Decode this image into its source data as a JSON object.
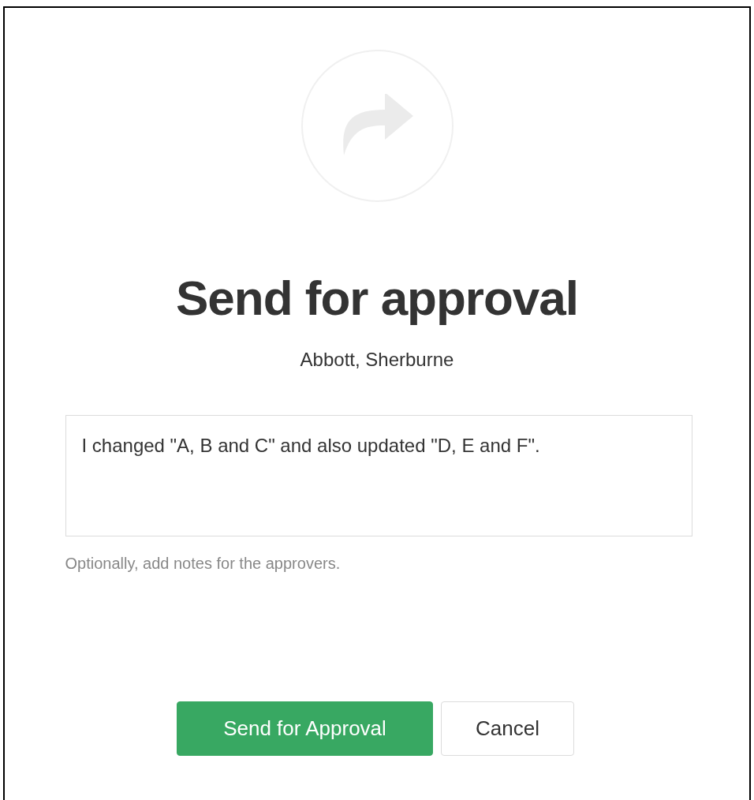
{
  "dialog": {
    "title": "Send for approval",
    "subtitle": "Abbott, Sherburne",
    "notes": {
      "value": "I changed \"A, B and C\" and also updated \"D, E and F\".",
      "help": "Optionally, add notes for the approvers."
    },
    "buttons": [
      {
        "label": "Send for Approval",
        "kind": "primary"
      },
      {
        "label": "Cancel",
        "kind": "secondary"
      }
    ]
  }
}
